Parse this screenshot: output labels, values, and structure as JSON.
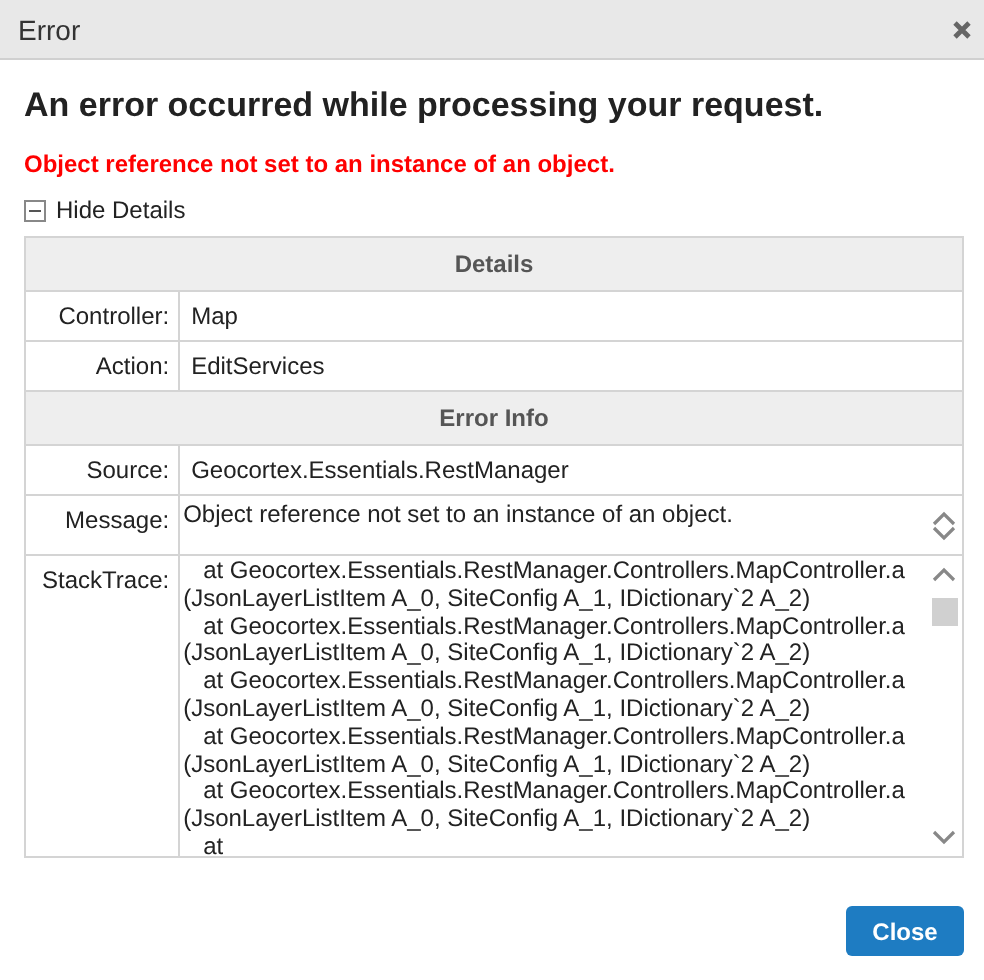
{
  "window": {
    "title": "Error"
  },
  "heading": "An error occurred while processing your request.",
  "error_message": "Object reference not set to an instance of an object.",
  "details_toggle": {
    "label": "Hide Details",
    "expanded": true
  },
  "details": {
    "sections": [
      {
        "title": "Details",
        "rows": [
          {
            "kind": "plain",
            "label": "Controller:",
            "value": "Map"
          },
          {
            "kind": "plain",
            "label": "Action:",
            "value": "EditServices"
          }
        ]
      },
      {
        "title": "Error Info",
        "rows": [
          {
            "kind": "plain",
            "label": "Source:",
            "value": "Geocortex.Essentials.RestManager"
          },
          {
            "kind": "scroll",
            "label": "Message:",
            "lines": [
              "Object reference not set to an instance of an object."
            ]
          },
          {
            "kind": "scroll",
            "label": "StackTrace:",
            "lines": [
              "   at Geocortex.Essentials.RestManager.Controllers.MapController.a",
              "(JsonLayerListItem A_0, SiteConfig A_1, IDictionary`2 A_2)",
              "   at Geocortex.Essentials.RestManager.Controllers.MapController.a",
              "(JsonLayerListItem A_0, SiteConfig A_1, IDictionary`2 A_2)",
              "   at Geocortex.Essentials.RestManager.Controllers.MapController.a",
              "(JsonLayerListItem A_0, SiteConfig A_1, IDictionary`2 A_2)",
              "   at Geocortex.Essentials.RestManager.Controllers.MapController.a",
              "(JsonLayerListItem A_0, SiteConfig A_1, IDictionary`2 A_2)",
              "   at Geocortex.Essentials.RestManager.Controllers.MapController.a",
              "(JsonLayerListItem A_0, SiteConfig A_1, IDictionary`2 A_2)",
              "   at"
            ]
          }
        ]
      }
    ]
  },
  "buttons": [
    {
      "label": "Close"
    }
  ]
}
